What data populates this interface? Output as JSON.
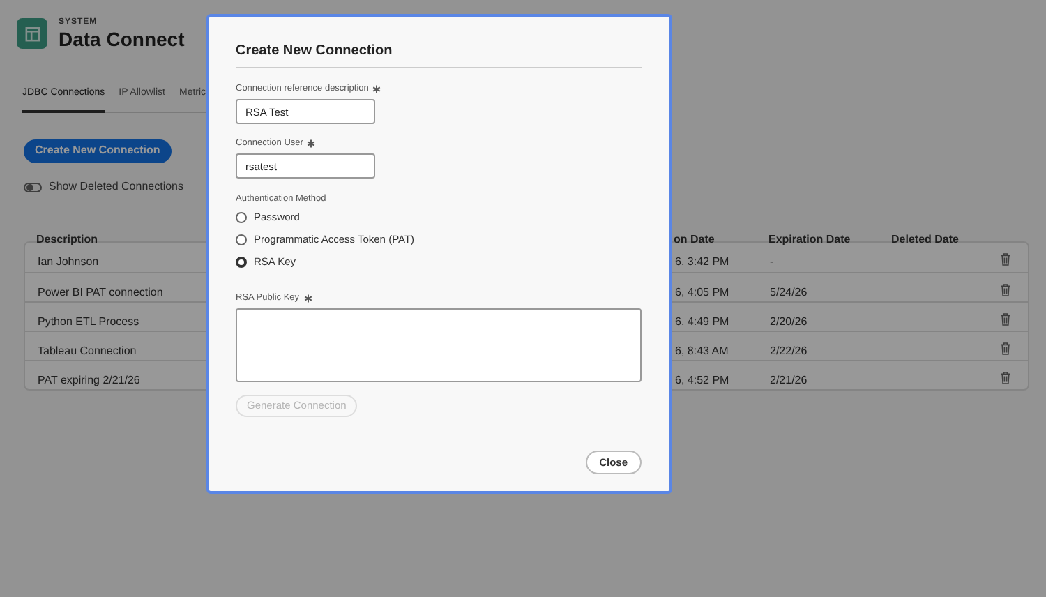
{
  "header": {
    "overline": "SYSTEM",
    "title": "Data Connect"
  },
  "tabs": [
    {
      "label": "JDBC Connections",
      "selected": true
    },
    {
      "label": "IP Allowlist",
      "selected": false
    },
    {
      "label": "Metric",
      "selected": false
    }
  ],
  "create_button": "Create New Connection",
  "show_deleted": {
    "label": "Show Deleted Connections",
    "on": false
  },
  "table": {
    "columns": [
      "Description",
      "on Date",
      "Expiration Date",
      "Deleted Date"
    ],
    "rows": [
      {
        "cells": [
          "Ian Johnson",
          "6, 3:42 PM",
          "-",
          ""
        ]
      },
      {
        "cells": [
          "Power BI PAT connection",
          "6, 4:05 PM",
          "5/24/26",
          ""
        ]
      },
      {
        "cells": [
          "Python ETL Process",
          "6, 4:49 PM",
          "2/20/26",
          ""
        ]
      },
      {
        "cells": [
          "Tableau Connection",
          "6, 8:43 AM",
          "2/22/26",
          ""
        ]
      },
      {
        "cells": [
          "PAT expiring 2/21/26",
          "6, 4:52 PM",
          "2/21/26",
          ""
        ]
      }
    ]
  },
  "dialog": {
    "title": "Create New Connection",
    "fields": [
      {
        "label": "Connection reference description",
        "required": true,
        "value": "RSA Test"
      },
      {
        "label": "Connection User",
        "required": true,
        "value": "rsatest"
      }
    ],
    "auth_label": "Authentication Method",
    "auth_options": [
      {
        "label": "Password",
        "selected": false
      },
      {
        "label": "Programmatic Access Token (PAT)",
        "selected": false
      },
      {
        "label": "RSA Key",
        "selected": true
      }
    ],
    "key_field": {
      "label": "RSA Public Key",
      "required": true
    },
    "generate_button": {
      "label": "Generate Connection",
      "disabled": true
    },
    "close_button": "Close"
  }
}
